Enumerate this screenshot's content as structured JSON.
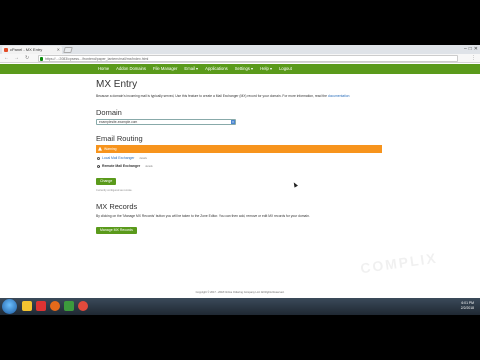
{
  "browser": {
    "tab_title": "cPanel - MX Entry",
    "url": "https://...:2083/cpsess.../frontend/paper_lantern/mail/mx/index.html",
    "window_controls": [
      "–",
      "□",
      "✕"
    ]
  },
  "nav": {
    "items": [
      {
        "label": "Home"
      },
      {
        "label": "Addon Domains"
      },
      {
        "label": "File Manager"
      },
      {
        "label": "Email ▾"
      },
      {
        "label": "Applications"
      },
      {
        "label": "Settings ▾"
      },
      {
        "label": "Help ▾"
      },
      {
        "label": "Logout"
      }
    ]
  },
  "page": {
    "title": "MX Entry",
    "description": "Because a domain's incoming mail is typically served, Use this feature to create a Mail Exchanger (MX) record for your domain. For more information, read the",
    "description_link": "documentation"
  },
  "domain": {
    "heading": "Domain",
    "selected": "examplesite-example.com"
  },
  "routing": {
    "heading": "Email Routing",
    "warning": "Warning",
    "options": [
      {
        "label": "Local Mail Exchanger",
        "note": "details",
        "checked": false
      },
      {
        "label": "Remote Mail Exchanger",
        "note": "details",
        "checked": true
      }
    ],
    "change_button": "Change",
    "note": "Currently configured as remote."
  },
  "mx_records": {
    "heading": "MX Records",
    "description": "By clicking on the 'Manage MX Records' button you will be taken to the Zone Editor. You can then add, remove or edit MX records for your domain.",
    "button": "Manage MX Records"
  },
  "footer": "Copyright © 2017 - 2018 Online Ordering Company LLC All Rights Reserved.",
  "taskbar": {
    "time": "6:01 PM",
    "date": "2/2/2018"
  },
  "colors": {
    "nav_green": "#5a9a1b",
    "warning_orange": "#f7941d",
    "link_blue": "#2a6ebb"
  }
}
